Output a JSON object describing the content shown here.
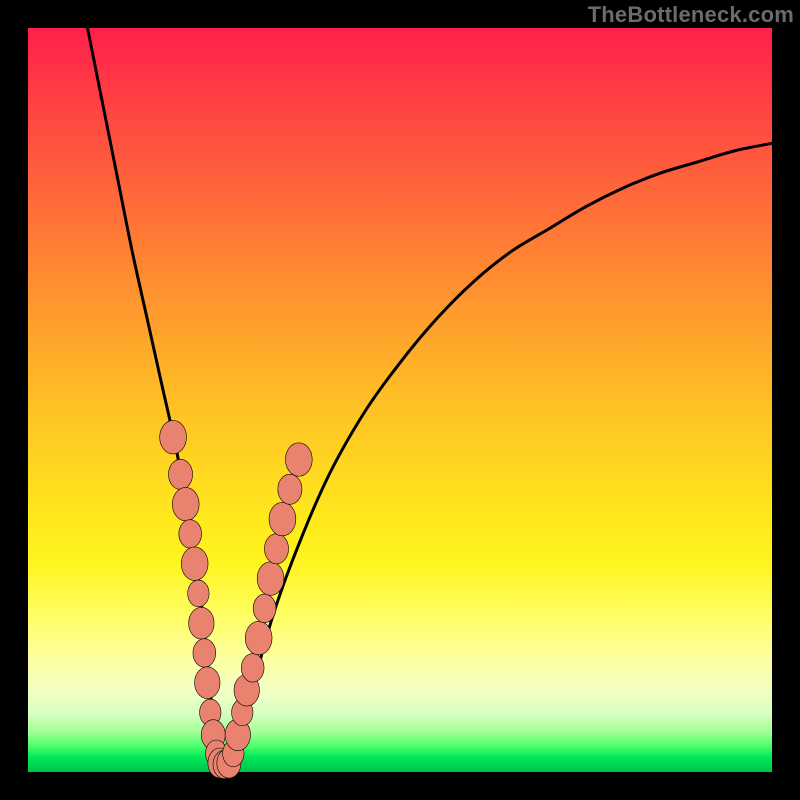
{
  "watermark": {
    "text": "TheBottleneck.com"
  },
  "colors": {
    "curve_stroke": "#000000",
    "bead_fill": "#e9836f",
    "bead_stroke": "#000000"
  },
  "chart_data": {
    "type": "line",
    "title": "",
    "xlabel": "",
    "ylabel": "",
    "xlim": [
      0,
      100
    ],
    "ylim": [
      0,
      100
    ],
    "grid": false,
    "legend": false,
    "annotations": [],
    "series": [
      {
        "name": "bottleneck-curve",
        "x": [
          8,
          10,
          12,
          14,
          16,
          18,
          20,
          22,
          23,
          24,
          25,
          26,
          27,
          28,
          30,
          32,
          35,
          40,
          45,
          50,
          55,
          60,
          65,
          70,
          75,
          80,
          85,
          90,
          95,
          100
        ],
        "y": [
          100,
          90,
          80,
          70,
          61,
          52,
          43,
          32,
          25,
          16,
          6,
          1,
          1,
          3,
          10,
          18,
          27,
          39,
          48,
          55,
          61,
          66,
          70,
          73,
          76,
          78.5,
          80.5,
          82,
          83.5,
          84.5
        ]
      }
    ],
    "beads": {
      "name": "highlight-beads",
      "points": [
        {
          "x": 19.5,
          "y": 45,
          "r": 2.0
        },
        {
          "x": 20.5,
          "y": 40,
          "r": 1.8
        },
        {
          "x": 21.2,
          "y": 36,
          "r": 2.0
        },
        {
          "x": 21.8,
          "y": 32,
          "r": 1.7
        },
        {
          "x": 22.4,
          "y": 28,
          "r": 2.0
        },
        {
          "x": 22.9,
          "y": 24,
          "r": 1.6
        },
        {
          "x": 23.3,
          "y": 20,
          "r": 1.9
        },
        {
          "x": 23.7,
          "y": 16,
          "r": 1.7
        },
        {
          "x": 24.1,
          "y": 12,
          "r": 1.9
        },
        {
          "x": 24.5,
          "y": 8,
          "r": 1.6
        },
        {
          "x": 24.9,
          "y": 5,
          "r": 1.8
        },
        {
          "x": 25.3,
          "y": 2.5,
          "r": 1.6
        },
        {
          "x": 25.8,
          "y": 1.2,
          "r": 1.8
        },
        {
          "x": 26.4,
          "y": 1.0,
          "r": 1.7
        },
        {
          "x": 27.0,
          "y": 1.2,
          "r": 1.8
        },
        {
          "x": 27.6,
          "y": 2.5,
          "r": 1.6
        },
        {
          "x": 28.2,
          "y": 5,
          "r": 1.9
        },
        {
          "x": 28.8,
          "y": 8,
          "r": 1.6
        },
        {
          "x": 29.4,
          "y": 11,
          "r": 1.9
        },
        {
          "x": 30.2,
          "y": 14,
          "r": 1.7
        },
        {
          "x": 31.0,
          "y": 18,
          "r": 2.0
        },
        {
          "x": 31.8,
          "y": 22,
          "r": 1.7
        },
        {
          "x": 32.6,
          "y": 26,
          "r": 2.0
        },
        {
          "x": 33.4,
          "y": 30,
          "r": 1.8
        },
        {
          "x": 34.2,
          "y": 34,
          "r": 2.0
        },
        {
          "x": 35.2,
          "y": 38,
          "r": 1.8
        },
        {
          "x": 36.4,
          "y": 42,
          "r": 2.0
        }
      ]
    }
  }
}
